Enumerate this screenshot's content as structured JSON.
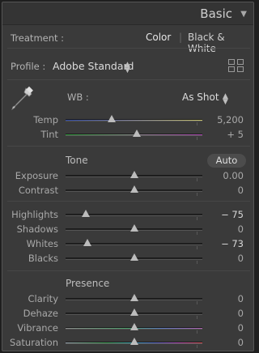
{
  "header": {
    "title": "Basic",
    "collapse_icon": "triangle-down-icon"
  },
  "treatment": {
    "label": "Treatment :",
    "color": "Color",
    "separator": "|",
    "bw": "Black & White"
  },
  "profile": {
    "label": "Profile :",
    "value": "Adobe Standard",
    "updown_icon": "updown-icon",
    "browser_icon": "grid-icon"
  },
  "wb": {
    "label": "WB :",
    "value": "As Shot",
    "dropper_icon": "eyedropper-icon"
  },
  "temp": {
    "label": "Temp",
    "value": "5,200",
    "position": 0.34
  },
  "tint": {
    "label": "Tint",
    "value": "+ 5",
    "position": 0.52
  },
  "tone": {
    "title": "Tone",
    "auto": "Auto"
  },
  "exposure": {
    "label": "Exposure",
    "value": "0.00",
    "position": 0.5
  },
  "contrast": {
    "label": "Contrast",
    "value": "0",
    "position": 0.5
  },
  "highlights": {
    "label": "Highlights",
    "value": "− 75",
    "position": 0.15
  },
  "shadows": {
    "label": "Shadows",
    "value": "0",
    "position": 0.5
  },
  "whites": {
    "label": "Whites",
    "value": "− 73",
    "position": 0.16
  },
  "blacks": {
    "label": "Blacks",
    "value": "0",
    "position": 0.5
  },
  "presence": {
    "title": "Presence"
  },
  "clarity": {
    "label": "Clarity",
    "value": "0",
    "position": 0.5
  },
  "dehaze": {
    "label": "Dehaze",
    "value": "0",
    "position": 0.5
  },
  "vibrance": {
    "label": "Vibrance",
    "value": "0",
    "position": 0.5
  },
  "saturation": {
    "label": "Saturation",
    "value": "0",
    "position": 0.5
  }
}
